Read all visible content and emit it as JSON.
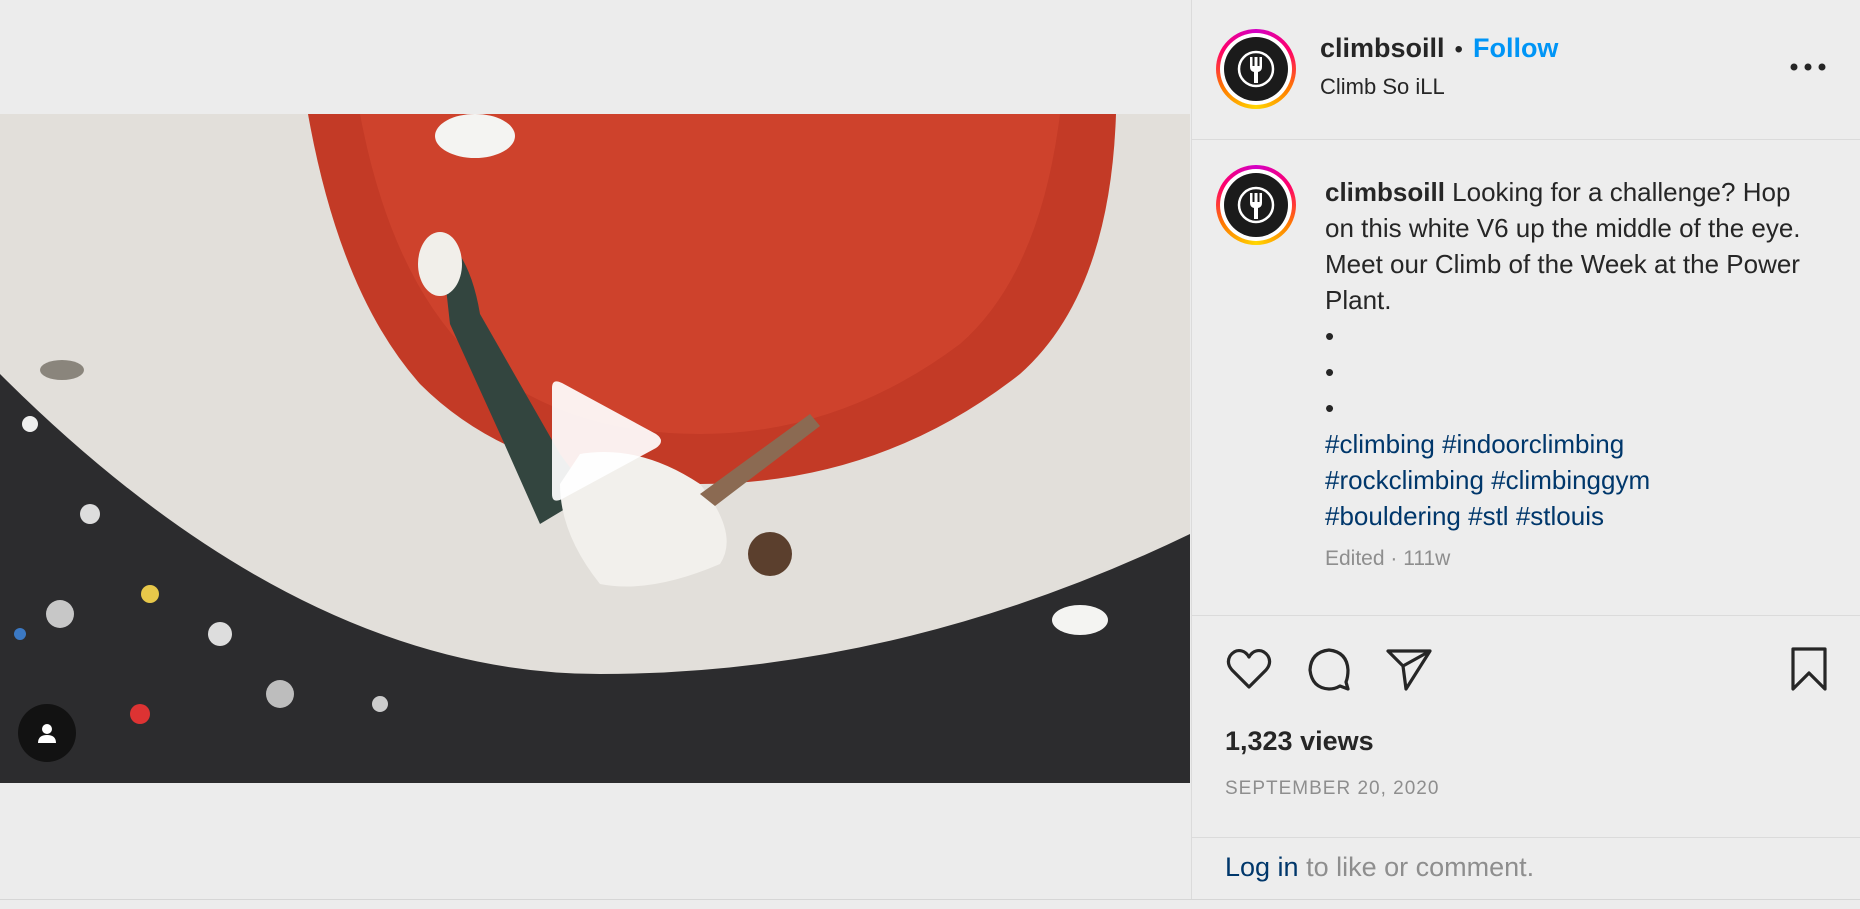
{
  "post": {
    "username": "climbsoill",
    "separator": "•",
    "follow_label": "Follow",
    "subtitle": "Climb So iLL",
    "more_label": "More options"
  },
  "caption": {
    "username": "climbsoill",
    "text": "Looking for a challenge? Hop on this white V6 up the middle of the eye. Meet our Climb of the Week at the Power Plant.",
    "bullets": [
      "•",
      "•",
      "•"
    ],
    "hashtags": [
      "#climbing",
      "#indoorclimbing",
      "#rockclimbing",
      "#climbinggym",
      "#bouldering",
      "#stl",
      "#stlouis"
    ],
    "meta": "Edited · 111w"
  },
  "actions": {
    "like_icon": "heart-icon",
    "comment_icon": "comment-icon",
    "share_icon": "send-icon",
    "save_icon": "bookmark-icon"
  },
  "stats": {
    "views": "1,323 views",
    "date": "SEPTEMBER 20, 2020"
  },
  "footer": {
    "login_link": "Log in",
    "login_rest": " to like or comment."
  },
  "colors": {
    "follow": "#0095f6",
    "hashtag": "#00376b",
    "muted": "#8e8e8e",
    "background": "#ededed"
  },
  "media": {
    "play_icon": "play-icon",
    "user_tag_icon": "user-icon"
  }
}
